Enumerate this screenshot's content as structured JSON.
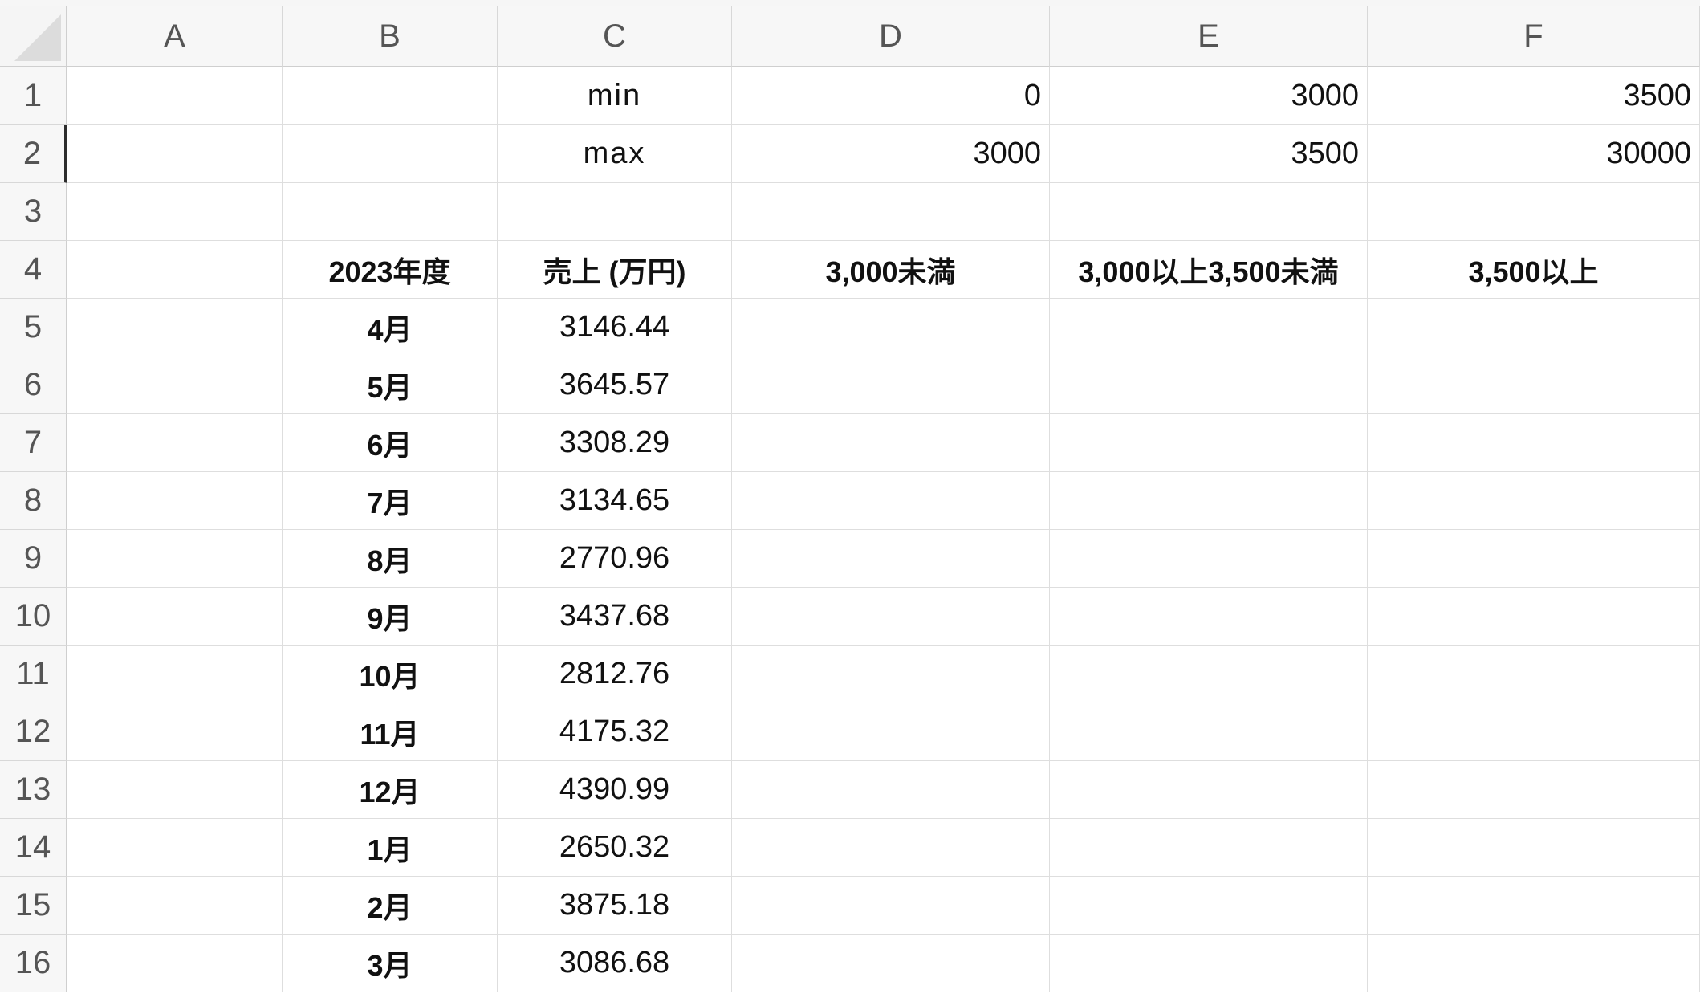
{
  "columns": [
    "A",
    "B",
    "C",
    "D",
    "E",
    "F"
  ],
  "rows": [
    "1",
    "2",
    "3",
    "4",
    "5",
    "6",
    "7",
    "8",
    "9",
    "10",
    "11",
    "12",
    "13",
    "14",
    "15",
    "16"
  ],
  "bounds": {
    "min_label": "min",
    "max_label": "max",
    "min_values": [
      "0",
      "3000",
      "3500"
    ],
    "max_values": [
      "3000",
      "3500",
      "30000"
    ]
  },
  "headers": {
    "year": "2023年度",
    "sales": "売上 (万円)",
    "range1": "3,000未満",
    "range2": "3,000以上3,500未満",
    "range3": "3,500以上"
  },
  "data_rows": [
    {
      "month": "4月",
      "sales": "3146.44"
    },
    {
      "month": "5月",
      "sales": "3645.57"
    },
    {
      "month": "6月",
      "sales": "3308.29"
    },
    {
      "month": "7月",
      "sales": "3134.65"
    },
    {
      "month": "8月",
      "sales": "2770.96"
    },
    {
      "month": "9月",
      "sales": "3437.68"
    },
    {
      "month": "10月",
      "sales": "2812.76"
    },
    {
      "month": "11月",
      "sales": "4175.32"
    },
    {
      "month": "12月",
      "sales": "4390.99"
    },
    {
      "month": "1月",
      "sales": "2650.32"
    },
    {
      "month": "2月",
      "sales": "3875.18"
    },
    {
      "month": "3月",
      "sales": "3086.68"
    }
  ],
  "active_row": "2"
}
